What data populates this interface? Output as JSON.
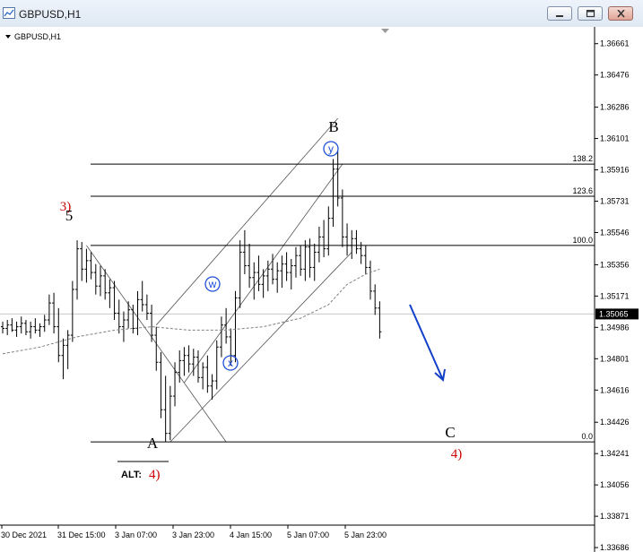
{
  "window": {
    "title": "GBPUSD,H1",
    "icon": "chart-window-icon",
    "buttons": [
      "minimize-icon",
      "maximize-icon",
      "close-icon"
    ]
  },
  "chart_data": {
    "type": "candlestick",
    "symbol_label": "GBPUSD,H1",
    "current_price": "1.35065",
    "price_axis": {
      "ticks": [
        "1.36661",
        "1.36476",
        "1.36286",
        "1.36101",
        "1.35916",
        "1.35731",
        "1.35546",
        "1.35356",
        "1.35171",
        "1.34986",
        "1.34801",
        "1.34616",
        "1.34426",
        "1.34241",
        "1.34056",
        "1.33871",
        "1.33686"
      ],
      "ylim": [
        1.3366,
        1.3676
      ]
    },
    "time_axis": {
      "ticks": [
        "30 Dec 2021",
        "31 Dec 15:00",
        "3 Jan 07:00",
        "3 Jan 23:00",
        "4 Jan 15:00",
        "5 Jan 07:00",
        "5 Jan 23:00"
      ]
    },
    "fibonacci_levels": [
      {
        "label": "138.2",
        "price": 1.3595
      },
      {
        "label": "123.6",
        "price": 1.3576
      },
      {
        "label": "100.0",
        "price": 1.3547
      },
      {
        "label": "0.0",
        "price": 1.3431
      }
    ],
    "wave_labels": [
      {
        "text": "3)",
        "color": "#cc0000"
      },
      {
        "text": "5",
        "color": "#000000"
      },
      {
        "text": "A",
        "color": "#000000"
      },
      {
        "text": "B",
        "color": "#000000"
      },
      {
        "text": "C",
        "color": "#000000"
      },
      {
        "text": "4)",
        "color": "#cc0000"
      },
      {
        "text": "w",
        "color": "#1d4fd8"
      },
      {
        "text": "x",
        "color": "#1d4fd8"
      },
      {
        "text": "y",
        "color": "#1d4fd8"
      }
    ],
    "alt_label": {
      "prefix": "ALT:",
      "wave": "4)"
    },
    "projection_arrow": {
      "color": "#1240c8",
      "direction": "down"
    },
    "candles": [
      [
        0,
        1.3499,
        1.3502,
        1.3495,
        1.3498
      ],
      [
        1,
        1.3498,
        1.3503,
        1.3494,
        1.35
      ],
      [
        2,
        1.35,
        1.3504,
        1.3496,
        1.3497
      ],
      [
        3,
        1.3497,
        1.3502,
        1.3493,
        1.3499
      ],
      [
        4,
        1.3499,
        1.3505,
        1.3495,
        1.3501
      ],
      [
        5,
        1.3501,
        1.3503,
        1.3494,
        1.3496
      ],
      [
        6,
        1.3496,
        1.3502,
        1.3492,
        1.3499
      ],
      [
        7,
        1.3499,
        1.3504,
        1.3495,
        1.3497
      ],
      [
        8,
        1.3497,
        1.3501,
        1.3493,
        1.3499
      ],
      [
        9,
        1.3499,
        1.3506,
        1.3496,
        1.3503
      ],
      [
        10,
        1.3503,
        1.3518,
        1.35,
        1.3513
      ],
      [
        11,
        1.3513,
        1.3519,
        1.3495,
        1.3499
      ],
      [
        12,
        1.3499,
        1.351,
        1.3478,
        1.3482
      ],
      [
        13,
        1.3482,
        1.3492,
        1.3468,
        1.3488
      ],
      [
        14,
        1.3488,
        1.3497,
        1.3474,
        1.3494
      ],
      [
        15,
        1.3494,
        1.3526,
        1.349,
        1.3521
      ],
      [
        16,
        1.3521,
        1.355,
        1.3515,
        1.3545
      ],
      [
        17,
        1.3545,
        1.3549,
        1.3526,
        1.3533
      ],
      [
        18,
        1.3533,
        1.3545,
        1.3525,
        1.3538
      ],
      [
        19,
        1.3538,
        1.3543,
        1.3527,
        1.3531
      ],
      [
        20,
        1.3531,
        1.3536,
        1.3518,
        1.3523
      ],
      [
        21,
        1.3523,
        1.3535,
        1.3517,
        1.3529
      ],
      [
        22,
        1.3529,
        1.3533,
        1.3515,
        1.3519
      ],
      [
        23,
        1.3519,
        1.3527,
        1.351,
        1.3522
      ],
      [
        24,
        1.3522,
        1.3526,
        1.3503,
        1.3507
      ],
      [
        25,
        1.3507,
        1.3515,
        1.3495,
        1.3499
      ],
      [
        26,
        1.3499,
        1.3508,
        1.349,
        1.3503
      ],
      [
        27,
        1.3503,
        1.3514,
        1.3498,
        1.3509
      ],
      [
        28,
        1.3509,
        1.3512,
        1.3495,
        1.3498
      ],
      [
        29,
        1.3498,
        1.352,
        1.3494,
        1.3515
      ],
      [
        30,
        1.3515,
        1.3526,
        1.3508,
        1.3512
      ],
      [
        31,
        1.3512,
        1.3518,
        1.3503,
        1.3507
      ],
      [
        32,
        1.3507,
        1.3512,
        1.349,
        1.3494
      ],
      [
        33,
        1.3494,
        1.3499,
        1.3473,
        1.3478
      ],
      [
        34,
        1.3478,
        1.3484,
        1.3445,
        1.345
      ],
      [
        35,
        1.345,
        1.347,
        1.3431,
        1.3436
      ],
      [
        36,
        1.3436,
        1.3464,
        1.3432,
        1.3458
      ],
      [
        37,
        1.3458,
        1.3478,
        1.3452,
        1.3472
      ],
      [
        38,
        1.3472,
        1.3485,
        1.3466,
        1.3479
      ],
      [
        39,
        1.3479,
        1.3487,
        1.347,
        1.3482
      ],
      [
        40,
        1.3482,
        1.3488,
        1.3472,
        1.3477
      ],
      [
        41,
        1.3477,
        1.3486,
        1.347,
        1.3481
      ],
      [
        42,
        1.3481,
        1.3485,
        1.3466,
        1.3469
      ],
      [
        43,
        1.3469,
        1.3478,
        1.3462,
        1.3475
      ],
      [
        44,
        1.3475,
        1.3482,
        1.346,
        1.3464
      ],
      [
        45,
        1.3464,
        1.3471,
        1.3456,
        1.3467
      ],
      [
        46,
        1.3467,
        1.3491,
        1.3462,
        1.3487
      ],
      [
        47,
        1.3487,
        1.3505,
        1.3481,
        1.35
      ],
      [
        48,
        1.35,
        1.351,
        1.3489,
        1.3493
      ],
      [
        49,
        1.3493,
        1.3498,
        1.3476,
        1.3482
      ],
      [
        50,
        1.3482,
        1.352,
        1.3478,
        1.3516
      ],
      [
        51,
        1.3516,
        1.355,
        1.351,
        1.3543
      ],
      [
        52,
        1.3543,
        1.3556,
        1.353,
        1.3535
      ],
      [
        53,
        1.3535,
        1.3548,
        1.3522,
        1.3528
      ],
      [
        54,
        1.3528,
        1.3537,
        1.3515,
        1.3531
      ],
      [
        55,
        1.3531,
        1.3541,
        1.352,
        1.3524
      ],
      [
        56,
        1.3524,
        1.3533,
        1.3516,
        1.3529
      ],
      [
        57,
        1.3529,
        1.3538,
        1.352,
        1.3533
      ],
      [
        58,
        1.3533,
        1.3542,
        1.3524,
        1.3527
      ],
      [
        59,
        1.3527,
        1.3537,
        1.3519,
        1.3532
      ],
      [
        60,
        1.3532,
        1.3541,
        1.3522,
        1.3536
      ],
      [
        61,
        1.3536,
        1.3543,
        1.3526,
        1.3531
      ],
      [
        62,
        1.3531,
        1.3539,
        1.3521,
        1.3535
      ],
      [
        63,
        1.3535,
        1.3546,
        1.3528,
        1.3541
      ],
      [
        64,
        1.3541,
        1.3547,
        1.3529,
        1.3533
      ],
      [
        65,
        1.3533,
        1.355,
        1.3526,
        1.3546
      ],
      [
        66,
        1.3546,
        1.3551,
        1.3528,
        1.3534
      ],
      [
        67,
        1.3534,
        1.3548,
        1.3526,
        1.3543
      ],
      [
        68,
        1.3543,
        1.3558,
        1.3537,
        1.3552
      ],
      [
        69,
        1.3552,
        1.3562,
        1.354,
        1.3545
      ],
      [
        70,
        1.3545,
        1.357,
        1.3541,
        1.3563
      ],
      [
        71,
        1.3563,
        1.3598,
        1.3558,
        1.3592
      ],
      [
        72,
        1.3592,
        1.3603,
        1.357,
        1.3575
      ],
      [
        73,
        1.3575,
        1.358,
        1.3546,
        1.3552
      ],
      [
        74,
        1.3552,
        1.356,
        1.3541,
        1.3547
      ],
      [
        75,
        1.3547,
        1.3556,
        1.3539,
        1.3551
      ],
      [
        76,
        1.3551,
        1.3556,
        1.3542,
        1.3545
      ],
      [
        77,
        1.3545,
        1.3549,
        1.3536,
        1.3541
      ],
      [
        78,
        1.3541,
        1.3547,
        1.353,
        1.3534
      ],
      [
        79,
        1.3534,
        1.3538,
        1.3515,
        1.352
      ],
      [
        80,
        1.352,
        1.3524,
        1.3506,
        1.351
      ],
      [
        81,
        1.351,
        1.3514,
        1.3492,
        1.3496
      ]
    ],
    "moving_average": [
      [
        0,
        1.3483
      ],
      [
        8,
        1.3487
      ],
      [
        16,
        1.3493
      ],
      [
        24,
        1.3497
      ],
      [
        32,
        1.3499
      ],
      [
        40,
        1.3497
      ],
      [
        48,
        1.3497
      ],
      [
        56,
        1.3499
      ],
      [
        64,
        1.3504
      ],
      [
        70,
        1.3512
      ],
      [
        74,
        1.3524
      ],
      [
        78,
        1.353
      ],
      [
        81,
        1.3533
      ]
    ],
    "channels": [
      {
        "name": "upper",
        "points": [
          [
            33,
            1.35
          ],
          [
            72,
            1.3622
          ]
        ]
      },
      {
        "name": "middle",
        "points": [
          [
            39,
            1.3466
          ],
          [
            73,
            1.3595
          ]
        ]
      },
      {
        "name": "lower",
        "points": [
          [
            36,
            1.3431
          ],
          [
            75,
            1.3543
          ]
        ]
      }
    ],
    "trendline_5_to_A": [
      [
        18,
        1.3547
      ],
      [
        48,
        1.3431
      ]
    ],
    "projection_points": [
      [
        87,
        1.3509
      ],
      [
        95,
        1.3463
      ]
    ]
  }
}
